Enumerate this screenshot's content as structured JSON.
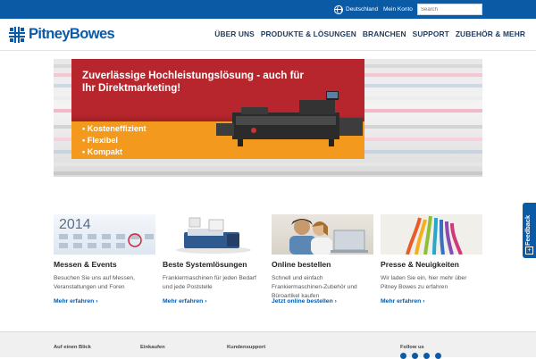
{
  "topbar": {
    "language": "Deutschland",
    "account": "Mein Konto",
    "search_placeholder": "Search"
  },
  "header": {
    "logo": "PitneyBowes",
    "nav": [
      "ÜBER UNS",
      "PRODUKTE & LÖSUNGEN",
      "BRANCHEN",
      "SUPPORT",
      "ZUBEHÖR & MEHR"
    ]
  },
  "hero": {
    "title": "Zuverlässige Hochleistungslösung - auch für Ihr Direktmarketing!",
    "bullets": [
      "• Kosteneffizient",
      "• Flexibel",
      "• Kompakt"
    ]
  },
  "cards": [
    {
      "image_label": "2014",
      "title": "Messen & Events",
      "text": "Besuchen Sie uns auf Messen, Veranstaltungen und Foren",
      "link": "Mehr erfahren ›"
    },
    {
      "title": "Beste Systemlösungen",
      "text": "Frankiermaschinen für jeden Bedarf und jede Poststelle",
      "link": "Mehr erfahren ›"
    },
    {
      "title": "Online bestellen",
      "text": "Schnell und einfach Frankiermaschinen-Zubehör und Büroartikel kaufen",
      "link": "Jetzt online bestellen ›"
    },
    {
      "title": "Presse & Neuigkeiten",
      "text": "Wir laden Sie ein, hier mehr über Pitney Bowes zu erfahren",
      "link": "Mehr erfahren ›"
    }
  ],
  "feedback": {
    "label": "Feedback",
    "plus": "+"
  },
  "footer": {
    "columns": [
      "Auf einen Blick",
      "Einkaufen",
      "Kundensupport",
      "Follow us"
    ]
  },
  "colors": {
    "brand_blue": "#0b5aa6",
    "hero_red": "#b8262d",
    "hero_orange": "#f39a1e"
  },
  "icons": [
    "globe-icon",
    "pitney-bowes-logo-icon",
    "feedback-plus-icon"
  ]
}
